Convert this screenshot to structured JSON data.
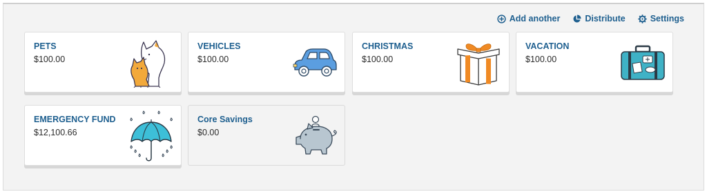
{
  "actions": {
    "add_label": "Add another",
    "distribute_label": "Distribute",
    "settings_label": "Settings"
  },
  "funds": [
    {
      "name": "PETS",
      "amount": "$100.00",
      "icon": "pets-icon"
    },
    {
      "name": "VEHICLES",
      "amount": "$100.00",
      "icon": "car-icon"
    },
    {
      "name": "CHRISTMAS",
      "amount": "$100.00",
      "icon": "gift-icon"
    },
    {
      "name": "VACATION",
      "amount": "$100.00",
      "icon": "suitcase-icon"
    },
    {
      "name": "EMERGENCY FUND",
      "amount": "$12,100.66",
      "icon": "umbrella-icon"
    },
    {
      "name": "Core Savings",
      "amount": "$0.00",
      "icon": "piggy-bank-icon"
    }
  ],
  "colors": {
    "link": "#1e5f8f",
    "panel": "#f3f3f3",
    "car": "#5b9ee0",
    "gift_ribbon": "#f08a24",
    "suitcase": "#3fb2c6",
    "umbrella": "#3dbfd8",
    "piggy": "#b8c6d0",
    "pet_orange": "#f2a93b"
  }
}
